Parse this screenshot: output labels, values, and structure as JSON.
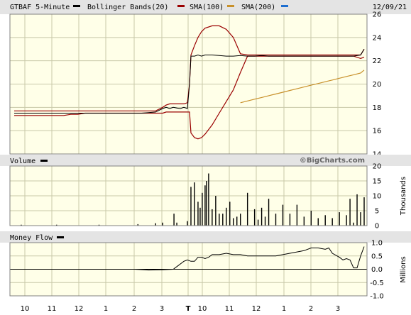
{
  "header": {
    "title": "GTBAF 5-Minute",
    "legend": [
      {
        "label": "Bollinger Bands(20)",
        "color": "#9a0000"
      },
      {
        "label": "SMA(100)",
        "color": "#c8902a"
      },
      {
        "label": "SMA(200)",
        "color": "#1f6fd0"
      }
    ],
    "date": "12/09/21"
  },
  "volume_header": {
    "label": "Volume"
  },
  "credit": "©BigCharts.com",
  "money_header": {
    "label": "Money Flow"
  },
  "units": {
    "volume": "Thousands",
    "money": "Millions"
  },
  "x_axis": {
    "labels": [
      "10",
      "11",
      "12",
      "1",
      "2",
      "3",
      "T",
      "10",
      "11",
      "12",
      "1",
      "2",
      "3"
    ]
  },
  "chart_data": [
    {
      "type": "line",
      "name": "price",
      "yticks": [
        14,
        16,
        18,
        20,
        22,
        24,
        26
      ],
      "ylim": [
        14,
        26
      ],
      "x": [
        0,
        10,
        20,
        30,
        40,
        50,
        60,
        70,
        80,
        90,
        100,
        110,
        120,
        130,
        140,
        150,
        160,
        170,
        180,
        190,
        200,
        210,
        215,
        220,
        225,
        230,
        235,
        240,
        245,
        248,
        250,
        255,
        260,
        265,
        270,
        280,
        290,
        300,
        310,
        320,
        330,
        340,
        350,
        360,
        370,
        380,
        390,
        400,
        410,
        420,
        430,
        440,
        450,
        460,
        470,
        480,
        490,
        495
      ],
      "close": [
        17.5,
        17.5,
        17.5,
        17.5,
        17.5,
        17.5,
        17.5,
        17.5,
        17.5,
        17.5,
        17.5,
        17.5,
        17.5,
        17.5,
        17.5,
        17.5,
        17.5,
        17.5,
        17.5,
        17.55,
        17.6,
        17.9,
        18.0,
        17.9,
        18.0,
        17.95,
        17.9,
        18.0,
        17.9,
        20.0,
        22.4,
        22.4,
        22.5,
        22.4,
        22.5,
        22.5,
        22.45,
        22.4,
        22.4,
        22.45,
        22.4,
        22.4,
        22.45,
        22.4,
        22.4,
        22.4,
        22.4,
        22.4,
        22.4,
        22.4,
        22.4,
        22.4,
        22.4,
        22.4,
        22.4,
        22.4,
        22.5,
        23.0
      ],
      "bollinger_upper": [
        17.7,
        17.7,
        17.7,
        17.7,
        17.7,
        17.7,
        17.7,
        17.7,
        17.7,
        17.7,
        17.7,
        17.7,
        17.7,
        17.7,
        17.7,
        17.7,
        17.7,
        17.7,
        17.7,
        17.7,
        17.7,
        18.0,
        18.2,
        18.3,
        18.3,
        18.3,
        18.3,
        18.3,
        18.4,
        20.0,
        22.5,
        23.3,
        24.0,
        24.5,
        24.8,
        25.0,
        25.0,
        24.7,
        24.0,
        22.6,
        22.5,
        22.5,
        22.5,
        22.5,
        22.5,
        22.5,
        22.5,
        22.5,
        22.5,
        22.5,
        22.5,
        22.5,
        22.5,
        22.5,
        22.5,
        22.5,
        22.5,
        23.0
      ],
      "bollinger_lower": [
        17.3,
        17.3,
        17.3,
        17.3,
        17.3,
        17.3,
        17.3,
        17.3,
        17.4,
        17.4,
        17.5,
        17.5,
        17.5,
        17.5,
        17.5,
        17.5,
        17.5,
        17.5,
        17.5,
        17.5,
        17.5,
        17.5,
        17.6,
        17.6,
        17.6,
        17.6,
        17.6,
        17.6,
        17.6,
        17.6,
        15.8,
        15.4,
        15.3,
        15.4,
        15.7,
        16.5,
        17.5,
        18.5,
        19.5,
        21.0,
        22.4,
        22.4,
        22.4,
        22.4,
        22.4,
        22.4,
        22.4,
        22.4,
        22.4,
        22.4,
        22.4,
        22.4,
        22.4,
        22.4,
        22.4,
        22.4,
        22.2,
        22.3
      ],
      "sma100": {
        "x": [
          320,
          330,
          340,
          350,
          360,
          370,
          380,
          390,
          400,
          410,
          420,
          430,
          440,
          450,
          460,
          470,
          480,
          490,
          495
        ],
        "values": [
          18.4,
          18.55,
          18.7,
          18.85,
          19.0,
          19.15,
          19.3,
          19.45,
          19.6,
          19.75,
          19.9,
          20.05,
          20.2,
          20.35,
          20.5,
          20.65,
          20.8,
          20.95,
          21.2
        ]
      }
    },
    {
      "type": "bar",
      "name": "volume",
      "yticks": [
        0,
        5,
        10,
        15,
        20
      ],
      "ylim": [
        0,
        20
      ],
      "x": [
        10,
        60,
        120,
        175,
        200,
        210,
        226,
        230,
        245,
        250,
        255,
        260,
        263,
        266,
        270,
        272,
        275,
        280,
        285,
        290,
        295,
        300,
        305,
        310,
        315,
        320,
        330,
        340,
        345,
        350,
        355,
        360,
        370,
        380,
        390,
        400,
        410,
        420,
        430,
        440,
        450,
        460,
        470,
        475,
        480,
        485,
        490,
        495
      ],
      "values": [
        0.3,
        0.3,
        0.3,
        0.5,
        0.8,
        1.0,
        4.0,
        1.0,
        1.5,
        13.0,
        14.5,
        8.0,
        6.0,
        11.0,
        13.5,
        15.0,
        17.5,
        5.5,
        10.0,
        4.0,
        4.0,
        6.0,
        8.0,
        2.5,
        3.0,
        4.0,
        11.0,
        5.5,
        2.0,
        6.0,
        3.0,
        9.0,
        4.0,
        7.0,
        4.0,
        7.0,
        3.0,
        5.0,
        2.5,
        3.5,
        2.5,
        4.5,
        3.5,
        9.0,
        1.0,
        10.5,
        4.5,
        9.5
      ]
    },
    {
      "type": "line",
      "name": "money flow",
      "yticks": [
        -1.0,
        -0.5,
        0.0,
        0.5,
        1.0
      ],
      "ytick_labels": [
        "-1.0",
        "-0.5",
        "0.0",
        "0.5",
        "1.0"
      ],
      "ylim": [
        -1.0,
        1.0
      ],
      "x": [
        0,
        170,
        190,
        210,
        225,
        230,
        240,
        245,
        250,
        255,
        260,
        265,
        270,
        275,
        280,
        290,
        300,
        310,
        320,
        330,
        340,
        350,
        360,
        370,
        380,
        390,
        400,
        410,
        420,
        430,
        440,
        445,
        450,
        460,
        465,
        470,
        475,
        480,
        485,
        490,
        495
      ],
      "values": [
        0.0,
        0.0,
        -0.03,
        -0.02,
        0.0,
        0.1,
        0.3,
        0.35,
        0.3,
        0.3,
        0.45,
        0.45,
        0.4,
        0.45,
        0.55,
        0.55,
        0.6,
        0.55,
        0.55,
        0.5,
        0.5,
        0.5,
        0.5,
        0.5,
        0.55,
        0.6,
        0.65,
        0.7,
        0.8,
        0.8,
        0.75,
        0.8,
        0.6,
        0.45,
        0.35,
        0.4,
        0.35,
        0.05,
        0.05,
        0.5,
        0.85
      ]
    }
  ]
}
